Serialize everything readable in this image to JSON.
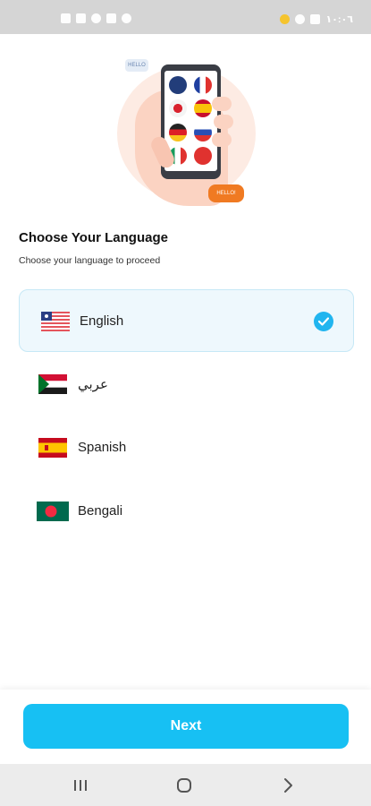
{
  "status_bar": {
    "left_icons": [
      "sim-icon",
      "signal-icon",
      "wifi-icon",
      "muted-icon",
      "alarm-icon"
    ],
    "right_icons": [
      "notification-icon",
      "cloud-icon",
      "image-icon"
    ],
    "time": "١٠:٠٦"
  },
  "illustration": {
    "bubble_left": "HELLO",
    "bubble_right": "HELLO!"
  },
  "heading": {
    "title": "Choose Your Language",
    "subtitle": "Choose your language to proceed"
  },
  "languages": [
    {
      "label": "English",
      "flag": "liberia-flag-icon",
      "selected": true
    },
    {
      "label": "عربي",
      "flag": "sudan-flag-icon",
      "selected": false
    },
    {
      "label": "Spanish",
      "flag": "spain-flag-icon",
      "selected": false
    },
    {
      "label": "Bengali",
      "flag": "bangladesh-flag-icon",
      "selected": false
    }
  ],
  "footer": {
    "next_label": "Next"
  },
  "nav_bar": {
    "buttons": [
      "recents-icon",
      "home-icon",
      "back-icon"
    ]
  },
  "colors": {
    "accent": "#17c0f3",
    "selected_bg": "#eef8fd",
    "check": "#21b5ef"
  }
}
